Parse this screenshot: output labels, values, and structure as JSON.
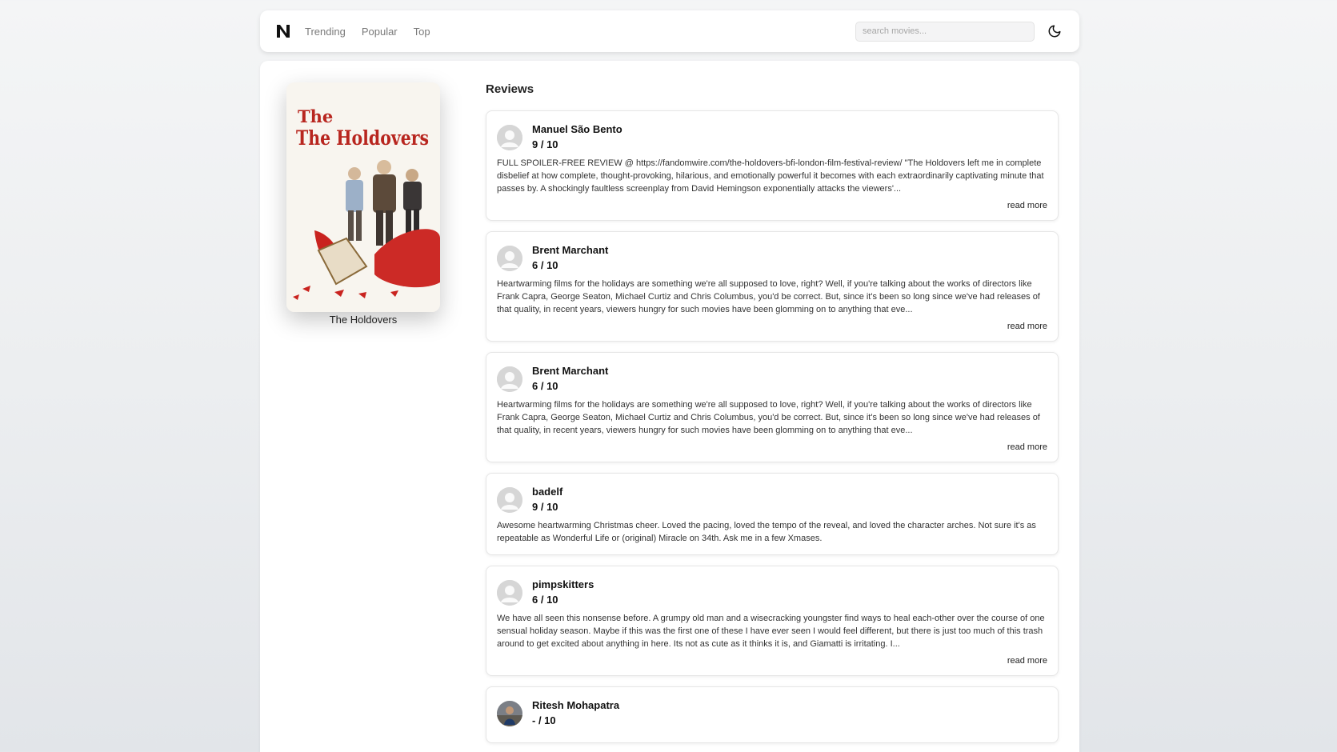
{
  "nav": {
    "logo_icon": "brand-logo-icon",
    "links": [
      "Trending",
      "Popular",
      "Top"
    ],
    "search_placeholder": "search movies...",
    "theme_icon": "moon-icon"
  },
  "movie": {
    "poster_title": "The Holdovers",
    "caption": "The Holdovers"
  },
  "reviews": {
    "heading": "Reviews",
    "read_more_label": "read more",
    "items": [
      {
        "author": "Manuel São Bento",
        "rating": "9 / 10",
        "text": "FULL SPOILER-FREE REVIEW @ https://fandomwire.com/the-holdovers-bfi-london-film-festival-review/ \"The Holdovers left me in complete disbelief at how complete, thought-provoking, hilarious, and emotionally powerful it becomes with each extraordinarily captivating minute that passes by. A shockingly faultless screenplay from David Hemingson exponentially attacks the viewers'...",
        "avatar": "default-avatar-icon"
      },
      {
        "author": "Brent Marchant",
        "rating": "6 / 10",
        "text": "Heartwarming films for the holidays are something we're all supposed to love, right? Well, if you're talking about the works of directors like Frank Capra, George Seaton, Michael Curtiz and Chris Columbus, you'd be correct. But, since it's been so long since we've had releases of that quality, in recent years, viewers hungry for such movies have been glomming on to anything that eve...",
        "avatar": "default-avatar-icon"
      },
      {
        "author": "Brent Marchant",
        "rating": "6 / 10",
        "text": "Heartwarming films for the holidays are something we're all supposed to love, right? Well, if you're talking about the works of directors like Frank Capra, George Seaton, Michael Curtiz and Chris Columbus, you'd be correct. But, since it's been so long since we've had releases of that quality, in recent years, viewers hungry for such movies have been glomming on to anything that eve...",
        "avatar": "default-avatar-icon"
      },
      {
        "author": "badelf",
        "rating": "9 / 10",
        "text": "Awesome heartwarming Christmas cheer. Loved the pacing, loved the tempo of the reveal, and loved the character arches. Not sure it's as repeatable as Wonderful Life or (original) Miracle on 34th. Ask me in a few Xmases.",
        "avatar": "default-avatar-icon"
      },
      {
        "author": "pimpskitters",
        "rating": "6 / 10",
        "text": "We have all seen this nonsense before. A grumpy old man and a wisecracking youngster find ways to heal each-other over the course of one sensual holiday season. Maybe if this was the first one of these I have ever seen I would feel different, but there is just too much of this trash around to get excited about anything in here. Its not as cute as it thinks it is, and Giamatti is irritating. I...",
        "avatar": "default-avatar-icon"
      },
      {
        "author": "Ritesh Mohapatra",
        "rating": "- / 10",
        "text": "",
        "avatar": "photo-avatar-icon"
      }
    ]
  }
}
